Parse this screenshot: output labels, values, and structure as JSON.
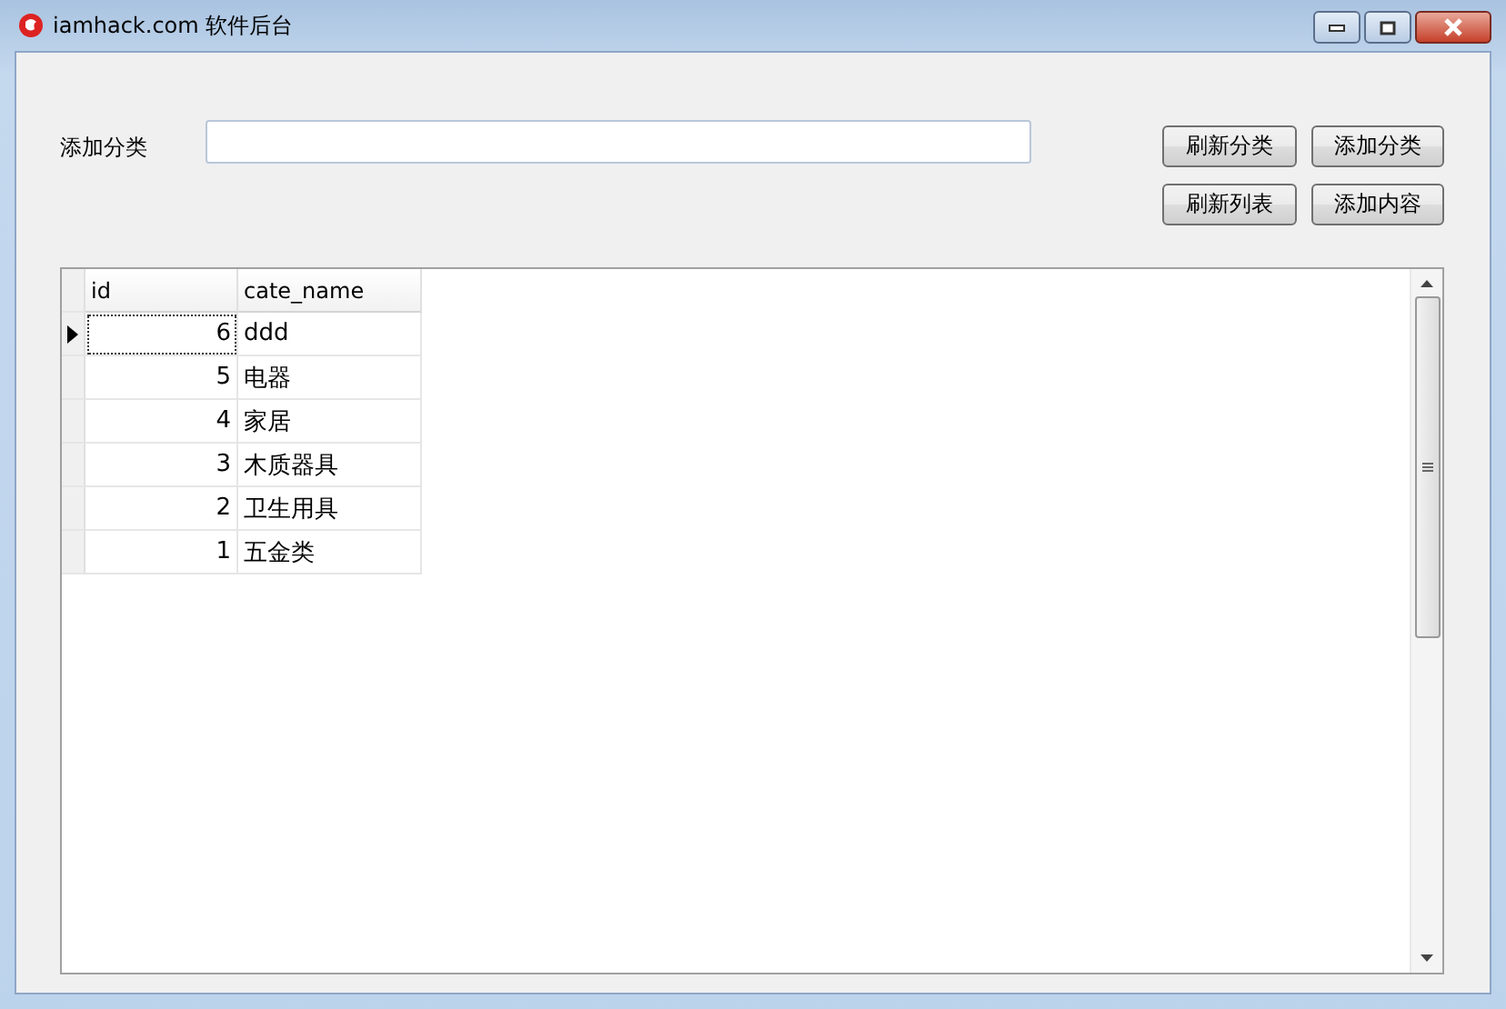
{
  "window": {
    "title": "iamhack.com 软件后台"
  },
  "form": {
    "label": "添加分类"
  },
  "buttons": [
    {
      "label": "刷新分类"
    },
    {
      "label": "添加分类"
    },
    {
      "label": "刷新列表"
    },
    {
      "label": "添加内容"
    }
  ],
  "table": {
    "columns": [
      "id",
      "cate_name"
    ],
    "rows": [
      {
        "id": "6",
        "cate_name": "ddd",
        "selected": true
      },
      {
        "id": "5",
        "cate_name": "电器",
        "selected": false
      },
      {
        "id": "4",
        "cate_name": "家居",
        "selected": false
      },
      {
        "id": "3",
        "cate_name": "木质器具",
        "selected": false
      },
      {
        "id": "2",
        "cate_name": "卫生用具",
        "selected": false
      },
      {
        "id": "1",
        "cate_name": "五金类",
        "selected": false
      }
    ]
  }
}
